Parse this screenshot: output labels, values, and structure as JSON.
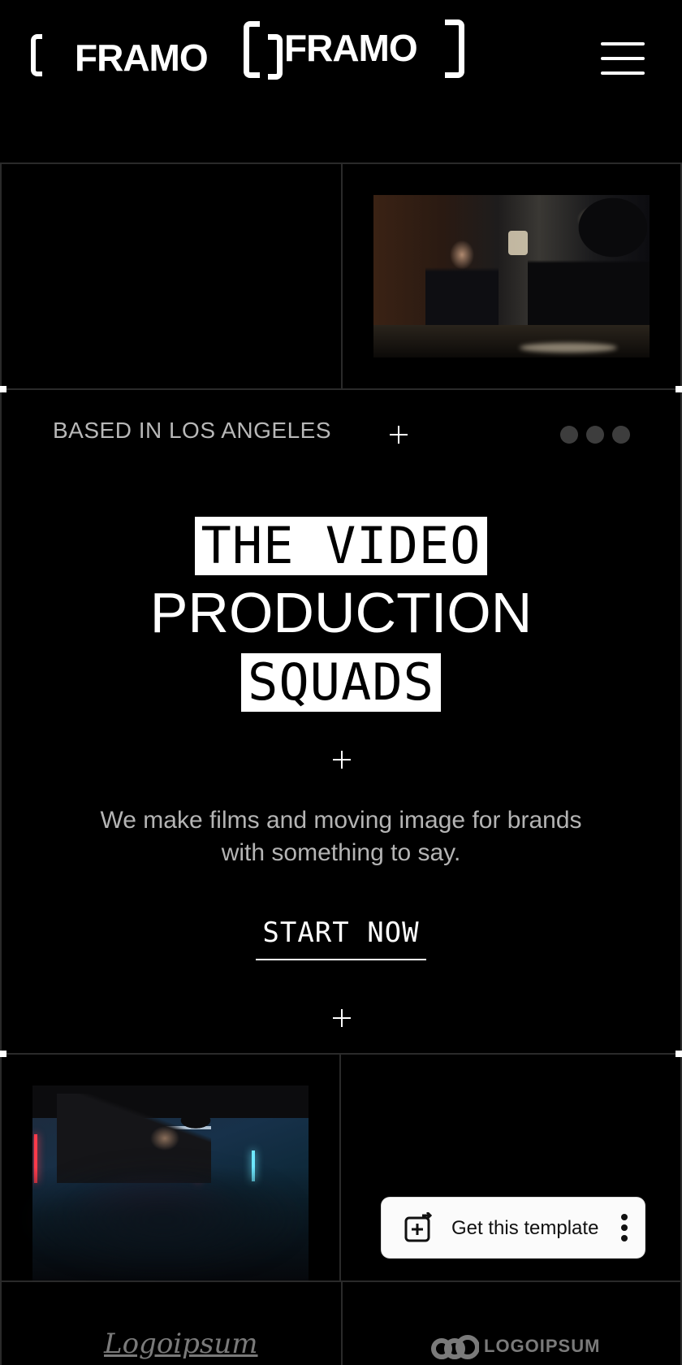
{
  "brand": {
    "logo_primary": "FRAMO",
    "logo_secondary": "FRAMO"
  },
  "header": {
    "menu_icon": "hamburger-menu-icon"
  },
  "hero": {
    "location": "BASED IN LOS ANGELES",
    "headline_line1": "THE VIDEO",
    "headline_line2": "PRODUCTION",
    "headline_line3": "SQUADS",
    "subtitle": "We make films and moving image for brands with something to say.",
    "cta_label": "START NOW"
  },
  "floating_button": {
    "label": "Get this template",
    "icon": "add-template-icon",
    "more_icon": "vertical-dots-icon"
  },
  "client_logos": [
    {
      "name": "Logoipsum"
    },
    {
      "name": "LOGOIPSUM"
    }
  ],
  "colors": {
    "background": "#000000",
    "foreground": "#ffffff",
    "muted_text": "#b4b4b4",
    "grid_line": "#2a2a2a",
    "dot": "#3d3d3d"
  }
}
